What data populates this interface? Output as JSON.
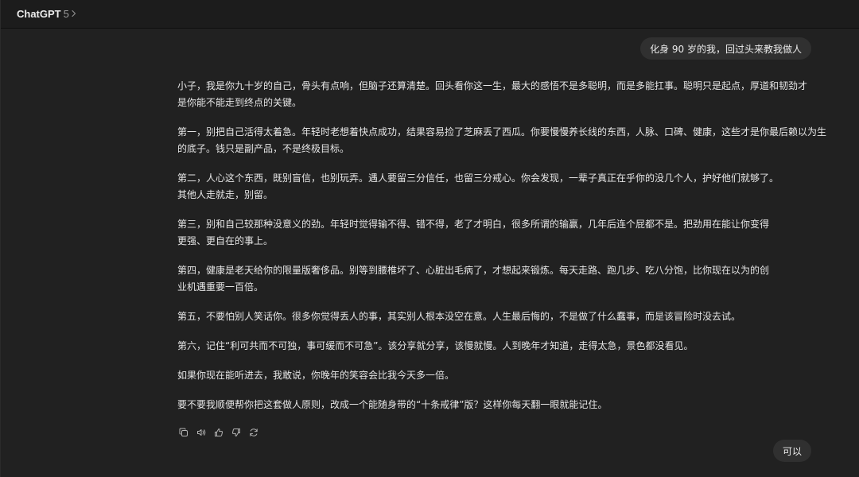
{
  "header": {
    "model_name": "ChatGPT",
    "model_version": "5"
  },
  "user_message": "化身 90 岁的我，回过头来教我做人",
  "assistant_message": {
    "paragraphs": [
      {
        "lines": [
          "小子，我是你九十岁的自己，骨头有点响，但脑子还算清楚。回头看你这一生，最大的感悟不是多聪明，而是多能扛事。聪明只是起点，厚道和韧劲才",
          "是你能不能走到终点的关键。"
        ]
      },
      {
        "lines": [
          "第一，别把自己活得太着急。年轻时老想着快点成功，结果容易捡了芝麻丢了西瓜。你要慢慢养长线的东西，人脉、口碑、健康，这些才是你最后赖以为生",
          "的底子。钱只是副产品，不是终极目标。"
        ]
      },
      {
        "lines": [
          "第二，人心这个东西，既别盲信，也别玩弄。遇人要留三分信任，也留三分戒心。你会发现，一辈子真正在乎你的没几个人，护好他们就够了。",
          "其他人走就走，别留。"
        ]
      },
      {
        "lines": [
          "第三，别和自己较那种没意义的劲。年轻时觉得输不得、错不得，老了才明白，很多所谓的输赢，几年后连个屁都不是。把劲用在能让你变得",
          "更强、更自在的事上。"
        ]
      },
      {
        "lines": [
          "第四，健康是老天给你的限量版奢侈品。别等到腰椎坏了、心脏出毛病了，才想起来锻炼。每天走路、跑几步、吃八分饱，比你现在以为的创",
          "业机遇重要一百倍。"
        ]
      },
      {
        "lines": [
          "第五，不要怕别人笑话你。很多你觉得丢人的事，其实别人根本没空在意。人生最后悔的，不是做了什么蠢事，而是该冒险时没去试。"
        ]
      },
      {
        "lines": [
          "第六，记住“利可共而不可独，事可缓而不可急”。该分享就分享，该慢就慢。人到晚年才知道，走得太急，景色都没看见。"
        ]
      },
      {
        "lines": [
          "如果你现在能听进去，我敢说，你晚年的笑容会比我今天多一倍。"
        ]
      },
      {
        "lines": [
          "要不要我顺便帮你把这套做人原则，改成一个能随身带的“十条戒律”版？这样你每天翻一眼就能记住。"
        ]
      }
    ]
  },
  "action_icons": [
    "copy-icon",
    "read-aloud-icon",
    "thumbs-up-icon",
    "thumbs-down-icon",
    "regenerate-icon"
  ],
  "reply_suggestion": "可以",
  "colors": {
    "background": "#212121",
    "header": "#1c1c1c",
    "bubble": "#303030",
    "text": "#ececec",
    "muted": "#9b9b9b"
  }
}
